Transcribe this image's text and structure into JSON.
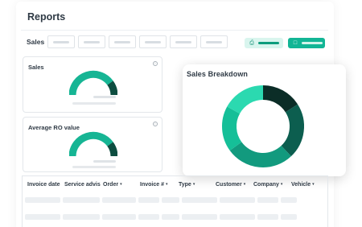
{
  "page": {
    "title": "Reports"
  },
  "filters": {
    "label": "Sales",
    "count": 6
  },
  "toolbar": {
    "print_icon": "printer-icon",
    "export_icon": "document-icon",
    "accent": "#12b595",
    "accent_light": "#d9f5ee"
  },
  "cards": [
    {
      "label": "Sales",
      "gauge_level": 0.8
    },
    {
      "label": "Average RO value",
      "gauge_level": 0.8
    }
  ],
  "breakdown": {
    "title": "Sales Breakdown",
    "colors": [
      "#0b2d27",
      "#0c5e4f",
      "#129a7e",
      "#15bf98",
      "#2bd9b0"
    ]
  },
  "chart_data": {
    "type": "pie",
    "title": "Sales Breakdown",
    "donut": true,
    "slices": [
      {
        "value": 16,
        "color": "#0b2d27"
      },
      {
        "value": 22,
        "color": "#0c5e4f"
      },
      {
        "value": 27,
        "color": "#129a7e"
      },
      {
        "value": 18,
        "color": "#15bf98"
      },
      {
        "value": 17,
        "color": "#2bd9b0"
      }
    ]
  },
  "table": {
    "columns": [
      {
        "label": "Invoice date",
        "sortable": false
      },
      {
        "label": "Service advis",
        "sortable": false
      },
      {
        "label": "Order",
        "sortable": true
      },
      {
        "label": "Invoice #",
        "sortable": true
      },
      {
        "label": "Type",
        "sortable": true
      },
      {
        "label": "Customer",
        "sortable": true
      },
      {
        "label": "Company",
        "sortable": true
      },
      {
        "label": "Vehicle",
        "sortable": true
      }
    ],
    "caret": "▾"
  }
}
